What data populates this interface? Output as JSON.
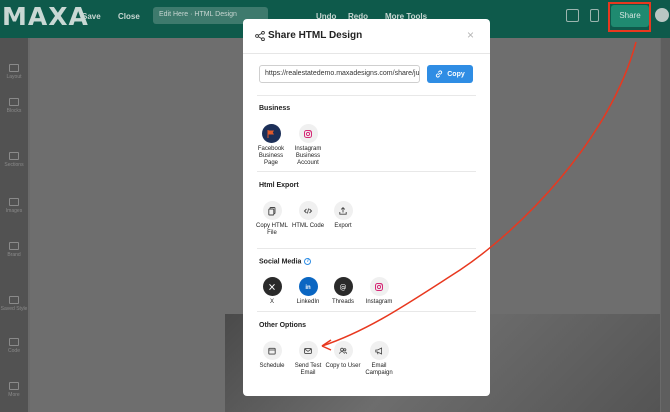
{
  "app": {
    "logo": "MAXA",
    "toolbar": {
      "save": "Save",
      "close": "Close",
      "design_name": "Edit Here · HTML Design",
      "preview": "Undo",
      "redo": "Redo",
      "more": "More Tools",
      "share": "Share"
    },
    "sidebar": [
      "Layout",
      "Blocks",
      "Sections",
      "Images",
      "Brand",
      "Saved Style",
      "Code",
      "More"
    ]
  },
  "modal": {
    "title": "Share HTML Design",
    "close_label": "×",
    "url_value": "https://realestatedemo.maxadesigns.com/share/jus",
    "copy_label": "Copy",
    "sections": {
      "business": {
        "title": "Business",
        "items": [
          {
            "label": "Facebook Business Page",
            "icon": "flag-icon"
          },
          {
            "label": "Instagram Business Account",
            "icon": "instagram-icon"
          }
        ]
      },
      "html_export": {
        "title": "Html Export",
        "items": [
          {
            "label": "Copy HTML File",
            "icon": "copy-file-icon"
          },
          {
            "label": "HTML Code",
            "icon": "code-icon"
          },
          {
            "label": "Export",
            "icon": "upload-icon"
          }
        ]
      },
      "social_media": {
        "title": "Social Media",
        "items": [
          {
            "label": "X",
            "icon": "x-icon"
          },
          {
            "label": "LinkedIn",
            "icon": "linkedin-icon"
          },
          {
            "label": "Threads",
            "icon": "threads-icon"
          },
          {
            "label": "Instagram",
            "icon": "instagram-icon"
          }
        ]
      },
      "other_options": {
        "title": "Other Options",
        "items": [
          {
            "label": "Schedule",
            "icon": "calendar-icon"
          },
          {
            "label": "Send Test Email",
            "icon": "email-icon"
          },
          {
            "label": "Copy to User",
            "icon": "users-icon"
          },
          {
            "label": "Email Campaign",
            "icon": "megaphone-icon"
          }
        ]
      }
    }
  },
  "colors": {
    "accent": "#2f8de4",
    "annotation": "#e8381f",
    "topbar": "#0e5a4b"
  }
}
